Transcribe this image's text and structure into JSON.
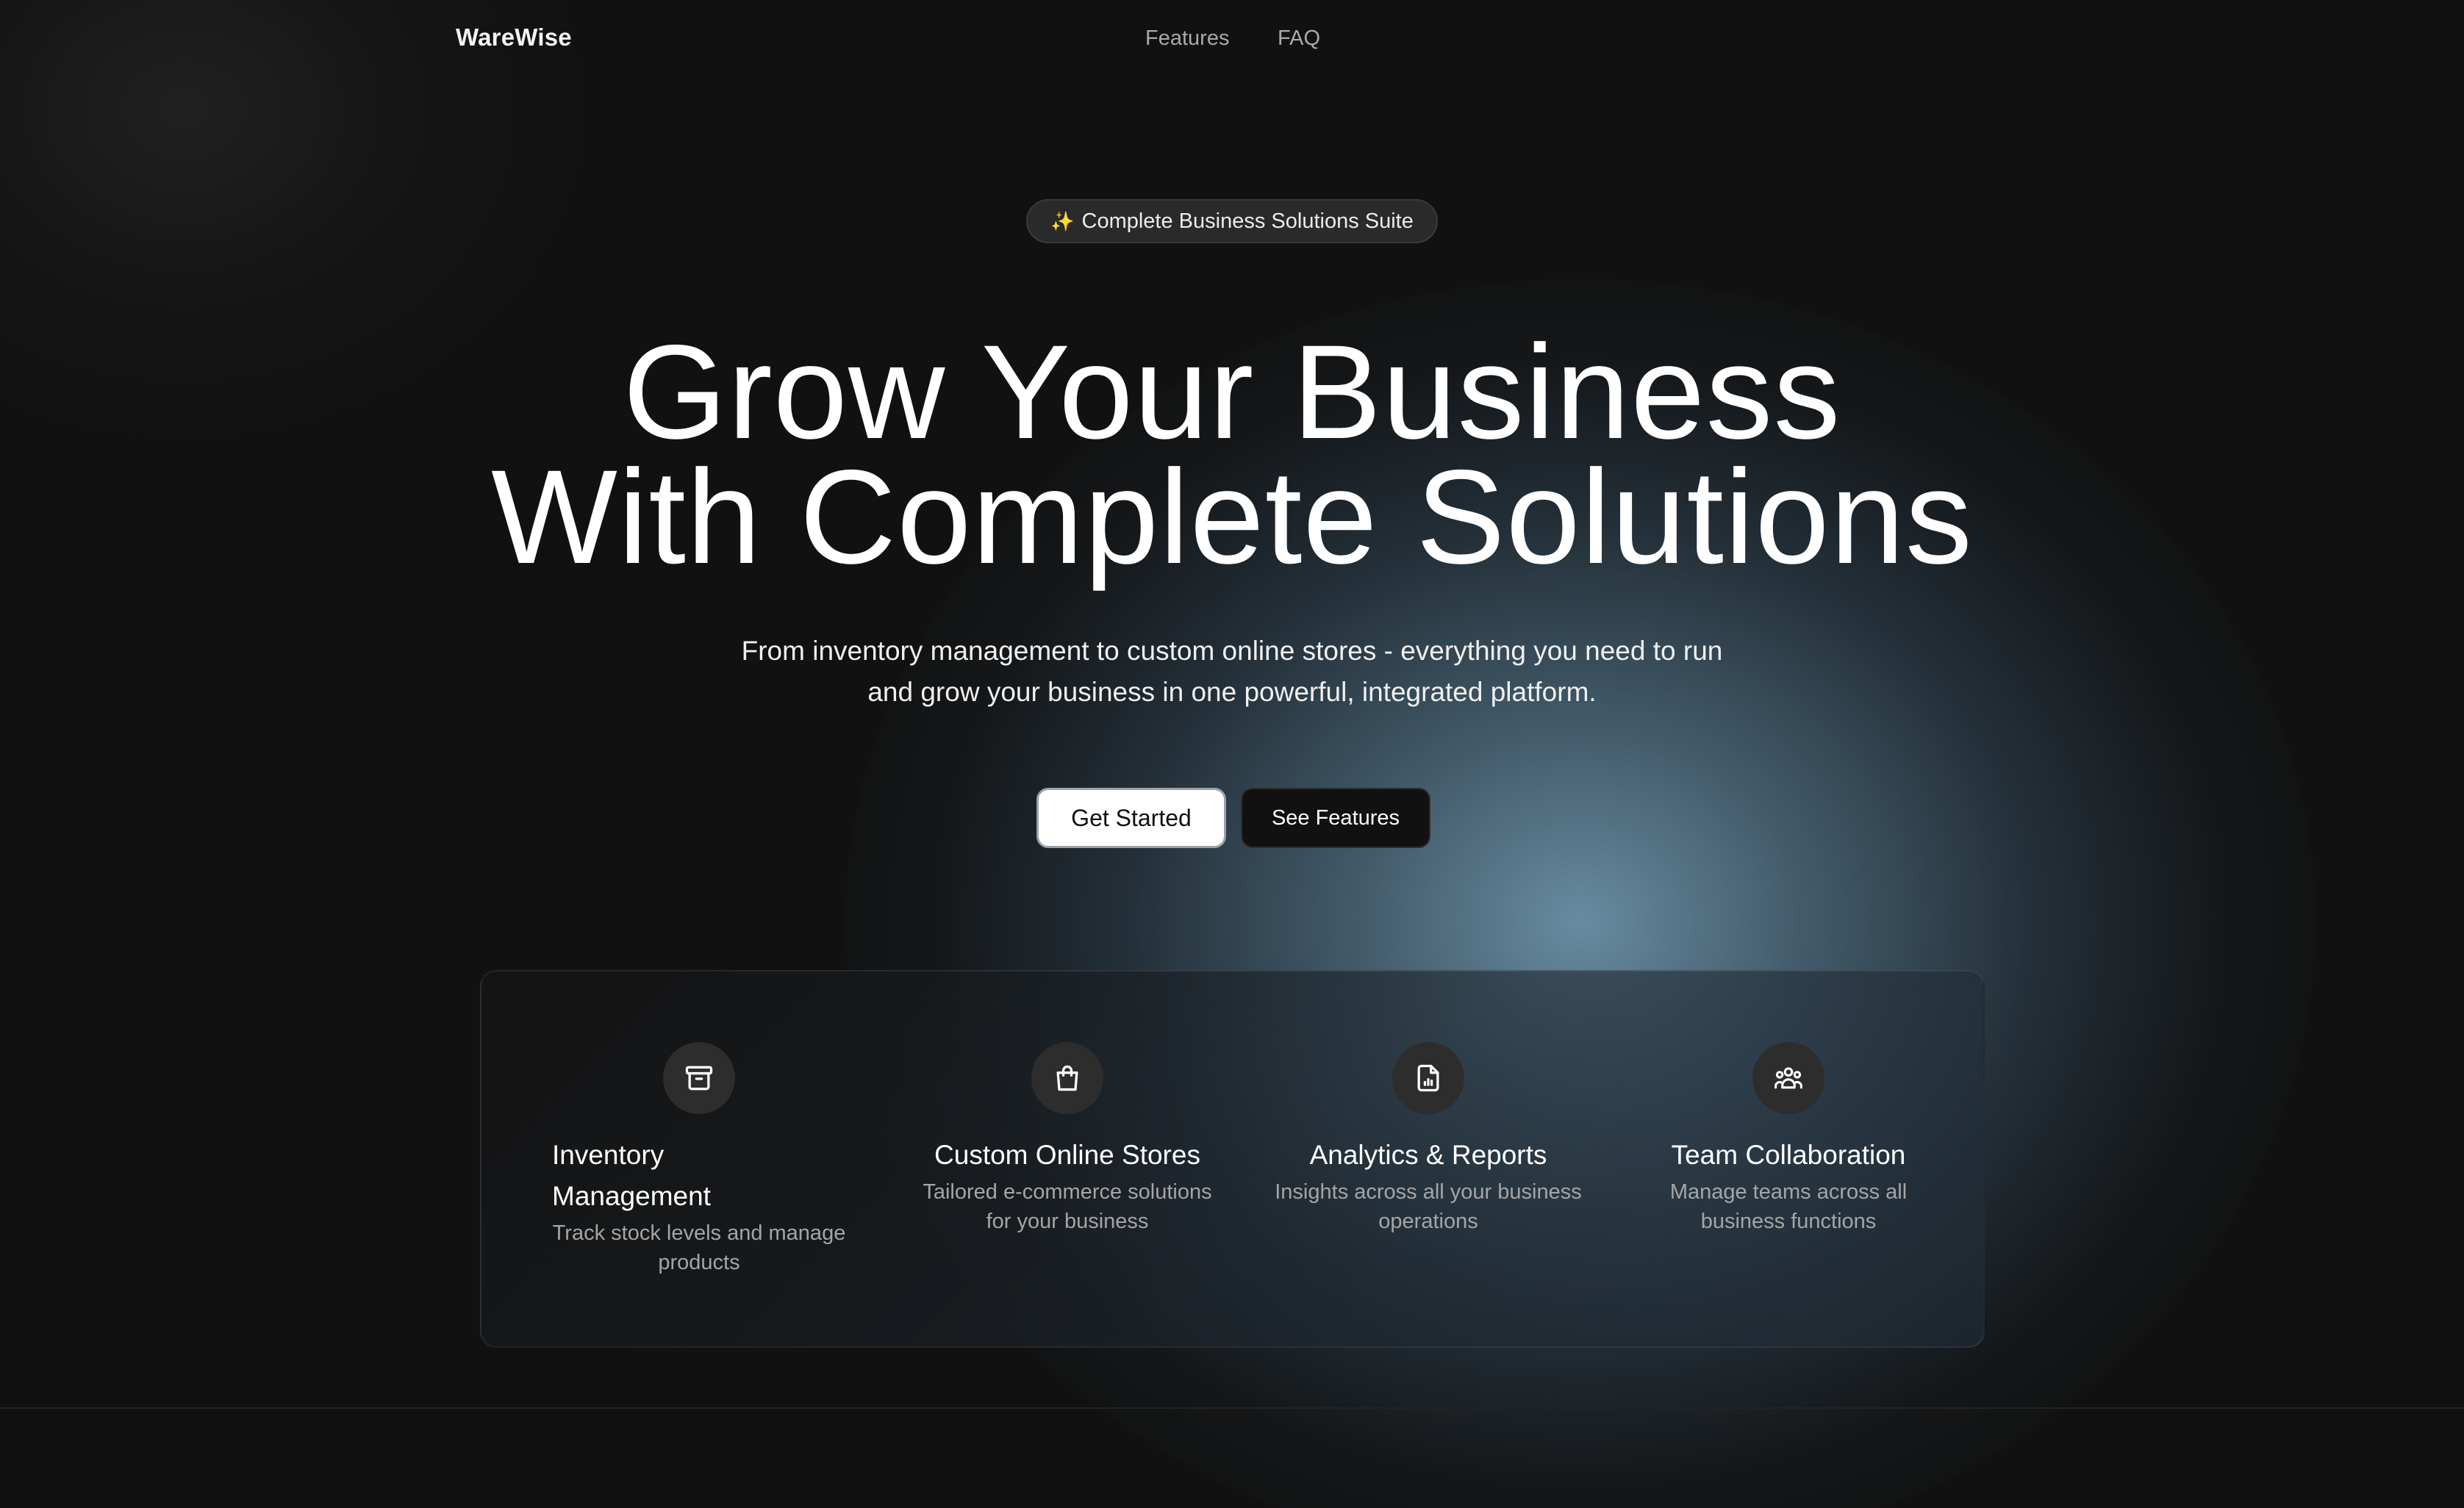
{
  "nav": {
    "brand": "WareWise",
    "links": [
      "Features",
      "FAQ"
    ]
  },
  "badge": {
    "icon": "sparkles-icon",
    "icon_glyph": "✨",
    "text": "Complete Business Solutions Suite"
  },
  "hero": {
    "title_line1": "Grow Your Business",
    "title_line2": "With Complete Solutions",
    "subtitle": "From inventory management to custom online stores - everything you need to run and grow your business in one powerful, integrated platform.",
    "primary_cta": "Get Started",
    "secondary_cta": "See Features"
  },
  "features": [
    {
      "icon": "archive-box-icon",
      "title": "Inventory Management",
      "description": "Track stock levels and manage products"
    },
    {
      "icon": "shopping-bag-icon",
      "title": "Custom Online Stores",
      "description": "Tailored e-commerce solutions for your business"
    },
    {
      "icon": "document-chart-icon",
      "title": "Analytics & Reports",
      "description": "Insights across all your business operations"
    },
    {
      "icon": "team-users-icon",
      "title": "Team Collaboration",
      "description": "Manage teams across all business functions"
    }
  ],
  "colors": {
    "background": "#111111",
    "glow": "#78a0b9",
    "primary_button_bg": "#ffffff",
    "secondary_button_bg": "#111111",
    "muted_text": "#a5a5a5"
  }
}
